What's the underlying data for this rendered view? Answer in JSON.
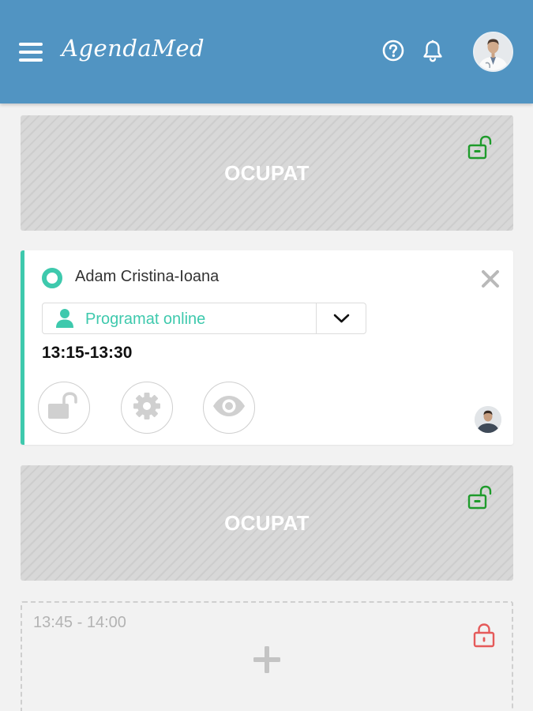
{
  "header": {
    "menu_icon": "hamburger-menu-icon",
    "logo": "AgendaMed",
    "help_icon": "help-circle-icon",
    "notifications_icon": "bell-icon",
    "avatar_icon": "doctor-avatar"
  },
  "colors": {
    "header_bg": "#5194c2",
    "accent": "#3ec9ad",
    "unlocked_green": "#1e9b2b",
    "locked_red": "#e55a5a"
  },
  "slots": [
    {
      "type": "busy",
      "label": "OCUPAT",
      "lock_icon": "unlock-green-icon"
    },
    {
      "type": "appointment",
      "patient_name": "Adam Cristina-Ioana",
      "status_label": "Programat online",
      "time_range": "13:15-13:30",
      "actions": [
        "unlock-icon",
        "gear-icon",
        "eye-icon"
      ],
      "close_icon": "close-icon"
    },
    {
      "type": "busy",
      "label": "OCUPAT",
      "lock_icon": "unlock-green-icon"
    },
    {
      "type": "free",
      "time_range": "13:45 - 14:00",
      "lock_icon": "lock-red-icon",
      "add_icon": "plus-icon"
    }
  ]
}
